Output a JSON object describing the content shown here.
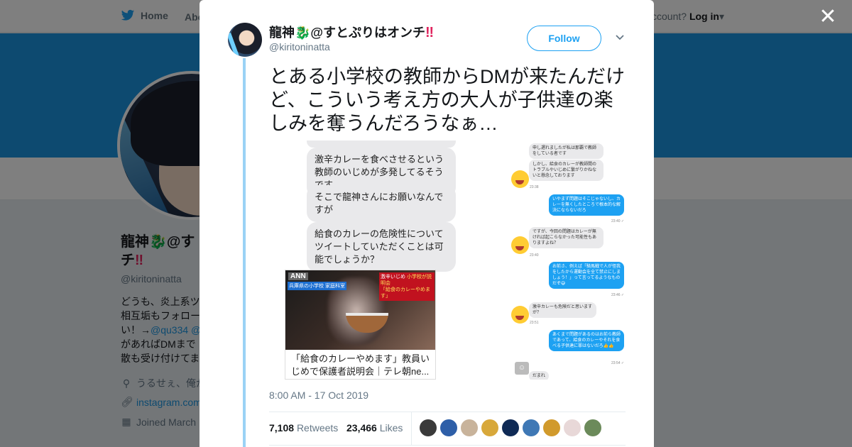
{
  "topbar": {
    "home_label": "Home",
    "about_label": "Abo",
    "account_prompt": "ccount?",
    "login_label": "Log in"
  },
  "profile": {
    "name_part1": "龍神",
    "name_emoji": "🐉",
    "name_part2": "@す",
    "name_line2": "チ",
    "name_bang": "‼",
    "handle": "@kiritoninatta",
    "bio_line1": "どうも、炎上系ツ",
    "bio_line2": "相互垢もフォロー",
    "bio_line3": "い！→",
    "bio_link": "@qu334 @",
    "bio_line4": "があればDMまで",
    "bio_line5": "散も受け付けてま",
    "location": "うるせぇ、俺が",
    "url": "instagram.com",
    "joined": "Joined March"
  },
  "modal": {
    "close_icon": "close-icon",
    "author_name_text": "龍神",
    "author_name_emoji": "🐉",
    "author_name_rest": "@すとぷりはオンチ",
    "author_name_bang": "‼",
    "author_handle": "@kiritoninatta",
    "follow_label": "Follow",
    "tweet_text": "とある小学校の教師からDMが来たんだけど、こういう考え方の大人が子供達の楽しみを奪うんだろうなぁ…",
    "timestamp": "8:00 AM - 17 Oct 2019",
    "retweets_count": "7,108",
    "retweets_label": "Retweets",
    "likes_count": "23,466",
    "likes_label": "Likes"
  },
  "media": {
    "left_bubbles": [
      "激辛カレーを食べさせるという教師のいじめが多発してるそうです",
      "そこで龍神さんにお願いなんですが",
      "給食のカレーの危険性についてツイートしていただくことは可能でしょうか？"
    ],
    "news": {
      "ann": "ANN",
      "tag": "兵庫県の小学校 家庭科室",
      "headline_1": "激辛いじめ",
      "headline_2": "小学校が説明会",
      "headline_3": "「給食のカレーやめます」",
      "caption": "「給食のカレーやめます」教員いじめで保護者説明会｜テレ朝ne..."
    },
    "right": {
      "b1": "申し遅れましたが私は那覇で教師をしている者です",
      "b2": "しかし、給食のカレーが教師間のトラブルやいじめに繋がりかねないと懸念しております",
      "t1": "23:38",
      "r1": "いやまず問題はそこじゃないし、カレーを無くしたところで根本的な解決にならないだろ",
      "t2": "23:40 ✓",
      "b3": "ですが、今回の問題はカレーが無ければ起こらなかった可能性もありますよね？",
      "t3": "23:40",
      "r2": "お前さ、例えば「騎馬戦で人が怪我をしたから運動会を全て禁止にしましょう！」って言ってるようなものだぞ😅",
      "t4": "23:46 ✓",
      "b4": "激辛カレーも危険だと思いますが？",
      "t5": "23:51",
      "r3": "あくまで問題があるのはお前ら教師であって、給食のカレーやそれを食べる子供達に罪はないだろ👍👍",
      "t6": "23:54 ✓",
      "b5": "だまれ"
    }
  },
  "colors": {
    "brand": "#1da1f2",
    "banner": "#1b95e0",
    "accent_red": "#e0245e"
  },
  "likers": [
    {
      "name": "liker-1",
      "color": "#3a3a3a"
    },
    {
      "name": "liker-2",
      "color": "#2e5fa8"
    },
    {
      "name": "liker-3",
      "color": "#c8b39b"
    },
    {
      "name": "liker-4",
      "color": "#d8a83a"
    },
    {
      "name": "liker-5",
      "color": "#0f2a55"
    },
    {
      "name": "liker-6",
      "color": "#3f78b5"
    },
    {
      "name": "liker-7",
      "color": "#d19a2c"
    },
    {
      "name": "liker-8",
      "color": "#e8d8d8"
    },
    {
      "name": "liker-9",
      "color": "#6b8a5a"
    }
  ]
}
